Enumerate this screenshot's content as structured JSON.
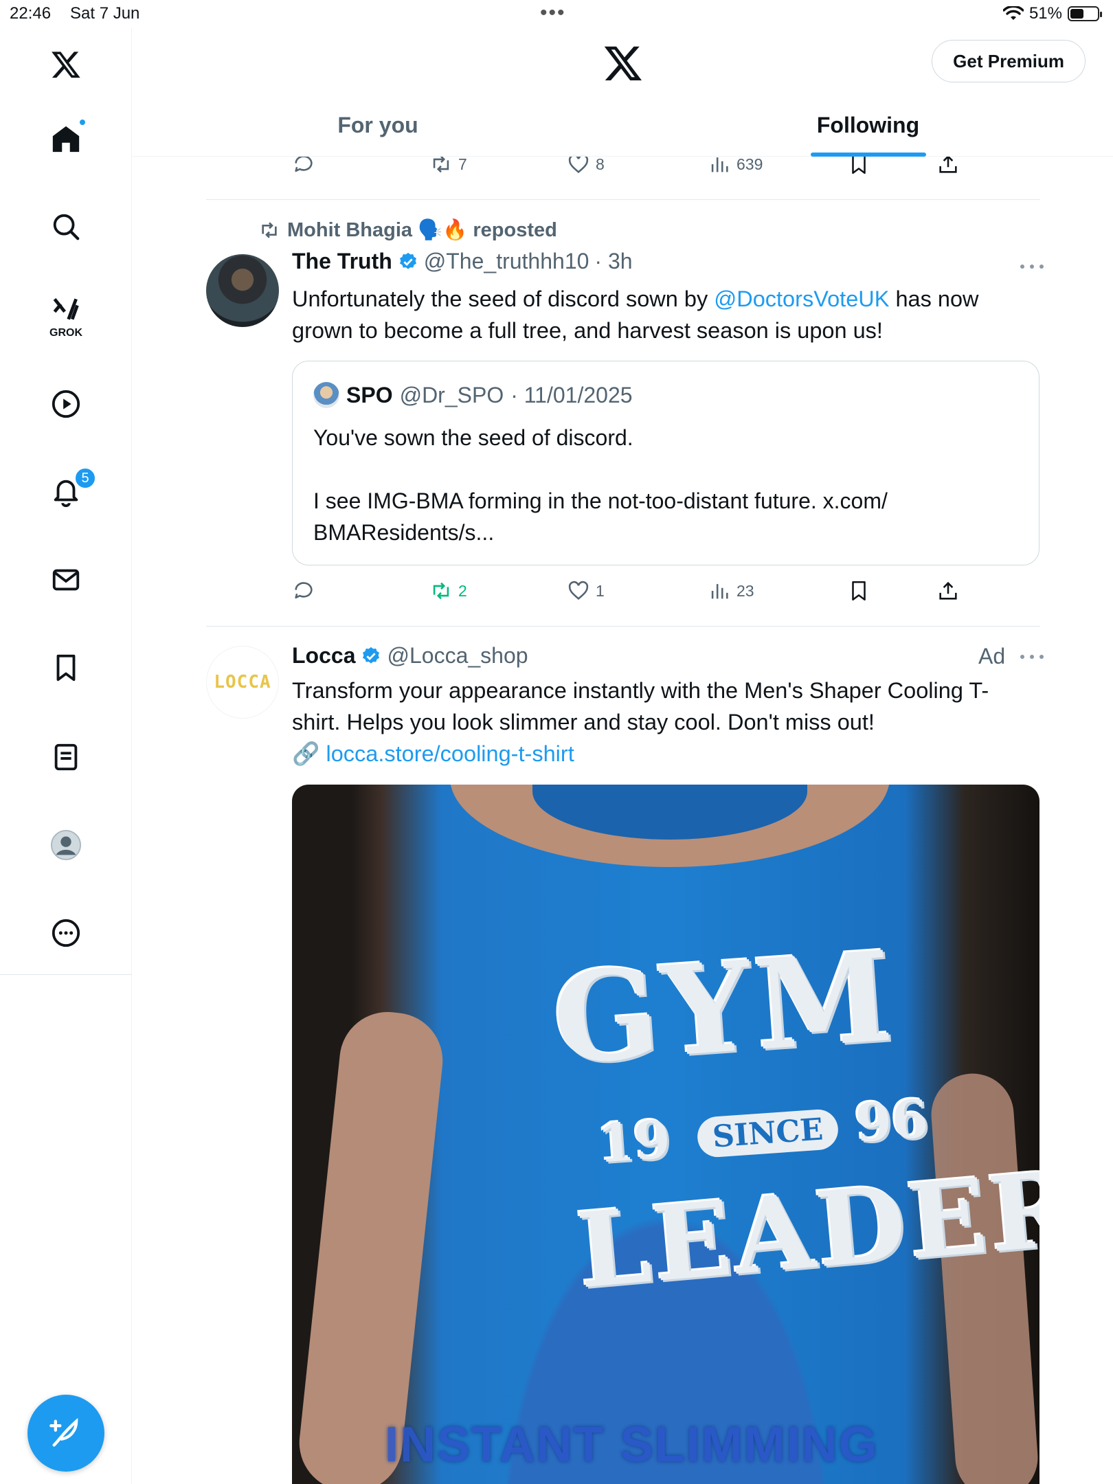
{
  "status_bar": {
    "time": "22:46",
    "date": "Sat 7 Jun",
    "battery": "51%",
    "battery_level": 0.51
  },
  "sidebar": {
    "items": [
      {
        "name": "home",
        "icon": "home-icon",
        "active": true
      },
      {
        "name": "search",
        "icon": "search-icon"
      },
      {
        "name": "grok",
        "icon": "grok-icon",
        "label": "GROK"
      },
      {
        "name": "videos",
        "icon": "play-icon"
      },
      {
        "name": "notifications",
        "icon": "bell-icon",
        "badge": "5"
      },
      {
        "name": "messages",
        "icon": "mail-icon"
      },
      {
        "name": "bookmarks",
        "icon": "bookmark-icon"
      },
      {
        "name": "lists",
        "icon": "list-icon"
      },
      {
        "name": "profile",
        "icon": "avatar-icon"
      },
      {
        "name": "more",
        "icon": "more-circle-icon"
      }
    ],
    "compose_icon": "compose-feather-icon"
  },
  "header": {
    "premium_label": "Get Premium",
    "tabs": [
      {
        "label": "For you",
        "active": false
      },
      {
        "label": "Following",
        "active": true
      }
    ]
  },
  "prev_post_actions": {
    "replies": "",
    "reposts": "7",
    "likes": "8",
    "views": "639"
  },
  "post1": {
    "repost_by": "Mohit Bhagia 🗣️🔥 reposted",
    "name": "The Truth",
    "handle": "@The_truthhh10",
    "time": "· 3h",
    "text_before": "Unfortunately the seed of discord sown by ",
    "mention": "@DoctorsVoteUK",
    "text_after": " has now grown to become a full tree, and harvest season is upon us!",
    "quote": {
      "name": "SPO",
      "handle": "@Dr_SPO",
      "date": "· 11/01/2025",
      "text": "You've sown the seed of discord.\n\nI see IMG-BMA forming in the not-too-distant future. x.com/\nBMAResidents/s..."
    },
    "actions": {
      "replies": "",
      "reposts": "2",
      "likes": "1",
      "views": "23"
    }
  },
  "post2": {
    "name": "Locca",
    "handle": "@Locca_shop",
    "ad_label": "Ad",
    "avatar_text": "LOCCA",
    "text": "Transform your appearance instantly with the Men's Shaper Cooling T-shirt. Helps you look slimmer and stay cool. Don't miss out!",
    "link_emoji": "🔗",
    "link": "locca.store/cooling-t-shirt",
    "media": {
      "shirt_line1": "GYM",
      "shirt_19": "19",
      "shirt_since": "SINCE",
      "shirt_96": "96",
      "shirt_line3": "LEADER",
      "caption": "INSTANT SLIMMING"
    }
  },
  "colors": {
    "accent": "#1d9bf0",
    "repost_green": "#00ba7c",
    "muted": "#536471",
    "text": "#0f1419"
  }
}
